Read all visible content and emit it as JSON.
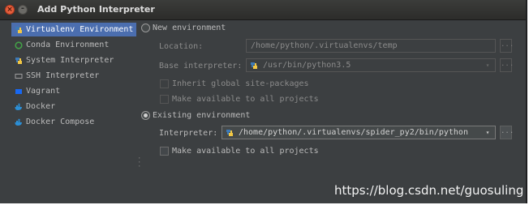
{
  "window": {
    "title": "Add Python Interpreter"
  },
  "sidebar": {
    "items": [
      {
        "label": "Virtualenv Environment",
        "icon": "virtualenv-icon",
        "selected": true
      },
      {
        "label": "Conda Environment",
        "icon": "conda-icon",
        "selected": false
      },
      {
        "label": "System Interpreter",
        "icon": "python-icon",
        "selected": false
      },
      {
        "label": "SSH Interpreter",
        "icon": "ssh-icon",
        "selected": false
      },
      {
        "label": "Vagrant",
        "icon": "vagrant-icon",
        "selected": false
      },
      {
        "label": "Docker",
        "icon": "docker-icon",
        "selected": false
      },
      {
        "label": "Docker Compose",
        "icon": "docker-compose-icon",
        "selected": false
      }
    ]
  },
  "new_env": {
    "radio_label": "New environment",
    "selected": false,
    "location_label": "Location:",
    "location_value": "/home/python/.virtualenvs/temp",
    "base_label": "Base interpreter:",
    "base_value": "/usr/bin/python3.5",
    "inherit_label": "Inherit global site-packages",
    "inherit_checked": false,
    "available_label": "Make available to all projects",
    "available_checked": false
  },
  "existing_env": {
    "radio_label": "Existing environment",
    "selected": true,
    "interpreter_label": "Interpreter:",
    "interpreter_value": "/home/python/.virtualenvs/spider_py2/bin/python",
    "available_label": "Make available to all projects",
    "available_checked": false
  },
  "browse_label": "...",
  "watermark": "https://blog.csdn.net/guosuling",
  "colors": {
    "background": "#3c3f41",
    "selection": "#4b6eaf",
    "text": "#bbbbbb",
    "disabled_text": "#8b8b8b"
  }
}
